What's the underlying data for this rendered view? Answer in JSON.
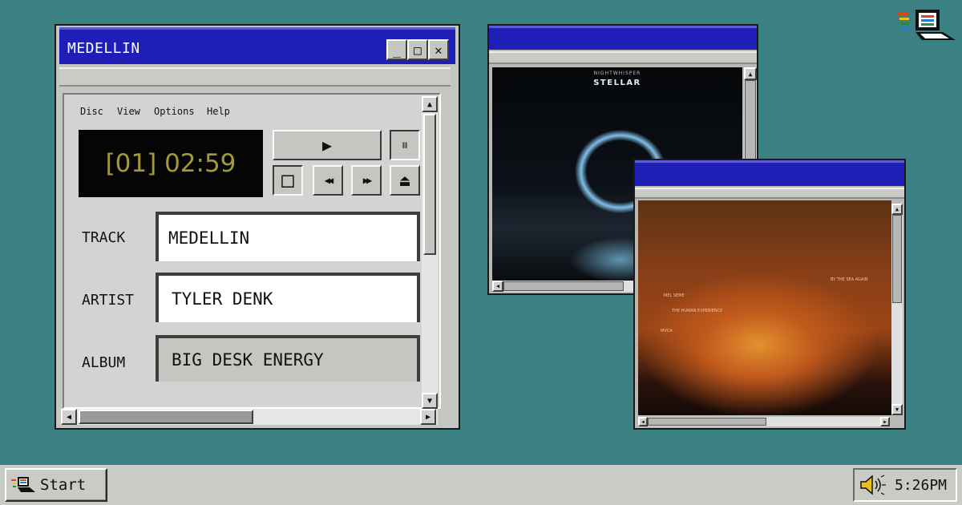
{
  "player": {
    "title": "MEDELLIN",
    "controls": {
      "minimize": "_",
      "maximize": "□",
      "close": "✕"
    },
    "menu": [
      "Disc",
      "View",
      "Options",
      "Help"
    ],
    "display": "[01] 02:59",
    "fields": [
      {
        "label": "TRACK",
        "value": "MEDELLIN"
      },
      {
        "label": "ARTIST",
        "value": "TYLER DENK"
      },
      {
        "label": "ALBUM",
        "value": "BIG DESK ENERGY"
      }
    ],
    "buttons": {
      "play": "▶",
      "pause": "⏸",
      "stop": "□",
      "rewind": "◀◀",
      "forward": "▶▶",
      "eject": "⏏"
    }
  },
  "album1": {
    "artist": "NIGHTWHISPER",
    "title": "STELLAR"
  },
  "album2": {
    "top_right": "BY THE SEA AGAIN",
    "line1": "MEL SEME",
    "line2": "THE HUMAN EXPERIENCE",
    "line3": "MVCA"
  },
  "taskbar": {
    "start_label": "Start",
    "time": "5:26PM"
  },
  "icons": {
    "desktop": "computer-icon",
    "start": "computer-icon",
    "tray": "speaker-icon"
  },
  "colors": {
    "desktop": "#3b8183",
    "titlebar": "#1f1fb8",
    "window": "#c4c6c2",
    "lcd_text": "#a29a3a"
  }
}
